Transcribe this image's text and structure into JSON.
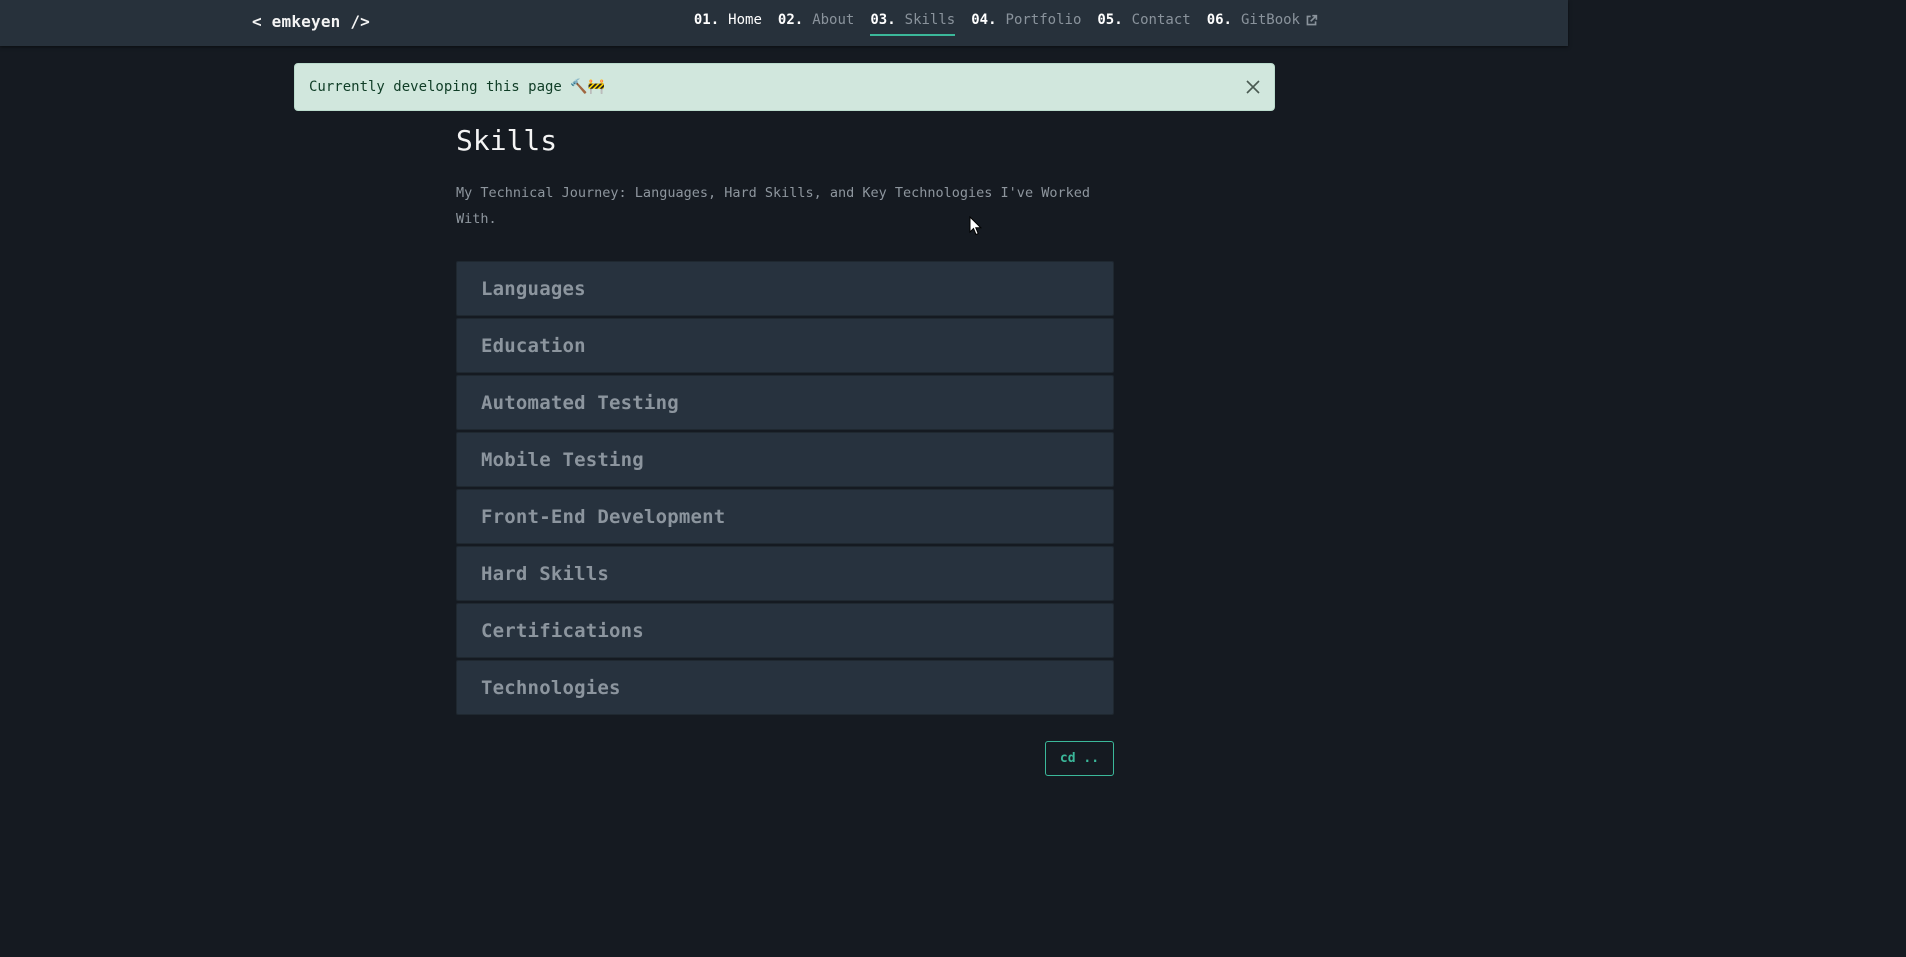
{
  "header": {
    "brand": "< emkeyen />",
    "nav": [
      {
        "num": "01.",
        "label": "Home"
      },
      {
        "num": "02.",
        "label": "About"
      },
      {
        "num": "03.",
        "label": "Skills"
      },
      {
        "num": "04.",
        "label": "Portfolio"
      },
      {
        "num": "05.",
        "label": "Contact"
      },
      {
        "num": "06.",
        "label": "GitBook"
      }
    ],
    "active_nav": "Skills",
    "external_icon": "external-link-icon"
  },
  "alert": {
    "text": "Currently developing this page 🔨🚧",
    "close_icon": "close-icon",
    "bg_color": "#d1e7dd"
  },
  "main": {
    "title": "Skills",
    "description": "My Technical Journey: Languages, Hard Skills, and Key Technologies I've Worked With.",
    "sections": [
      {
        "label": "Languages"
      },
      {
        "label": "Education"
      },
      {
        "label": "Automated Testing"
      },
      {
        "label": "Mobile Testing"
      },
      {
        "label": "Front-End Development"
      },
      {
        "label": "Hard Skills"
      },
      {
        "label": "Certifications"
      },
      {
        "label": "Technologies"
      }
    ]
  },
  "footer": {
    "back_label": "cd .."
  },
  "colors": {
    "accent": "#3bb89a",
    "background": "#151a21",
    "navbar": "#27313b",
    "panel": "#27323e"
  }
}
